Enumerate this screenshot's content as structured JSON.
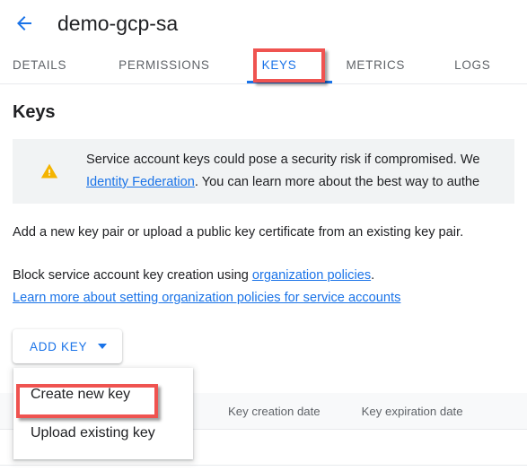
{
  "header": {
    "back_icon": "arrow-left-icon",
    "title": "demo-gcp-sa"
  },
  "tabs": [
    {
      "label": "DETAILS",
      "active": false
    },
    {
      "label": "PERMISSIONS",
      "active": false
    },
    {
      "label": "KEYS",
      "active": true
    },
    {
      "label": "METRICS",
      "active": false
    },
    {
      "label": "LOGS",
      "active": false
    }
  ],
  "main": {
    "section_title": "Keys",
    "warning": {
      "icon": "warning-triangle-icon",
      "line1": "Service account keys could pose a security risk if compromised. We",
      "link": "Identity Federation",
      "line2_rest": ". You can learn more about the best way to authe"
    },
    "paragraph_add": "Add a new key pair or upload a public key certificate from an existing key pair.",
    "block": {
      "line1_prefix": "Block service account key creation using ",
      "line1_link": "organization policies",
      "line1_suffix": ".",
      "line2_link": "Learn more about setting organization policies for service accounts"
    },
    "add_key_button": {
      "label": "ADD KEY",
      "caret_icon": "chevron-down-icon"
    },
    "menu": {
      "items": [
        {
          "label": "Create new key",
          "highlighted": true
        },
        {
          "label": "Upload existing key",
          "highlighted": false
        }
      ]
    },
    "table": {
      "columns": [
        "Key creation date",
        "Key expiration date"
      ],
      "rows": []
    }
  },
  "annotations": {
    "color": "#ef5350",
    "targets": [
      "KEYS",
      "Create new key"
    ]
  },
  "colors": {
    "accent": "#1a73e8",
    "warning": "#f4b400",
    "text": "#202124",
    "muted": "#5f6368",
    "banner_bg": "#f1f3f4",
    "table_header_bg": "#f8f9fa"
  }
}
